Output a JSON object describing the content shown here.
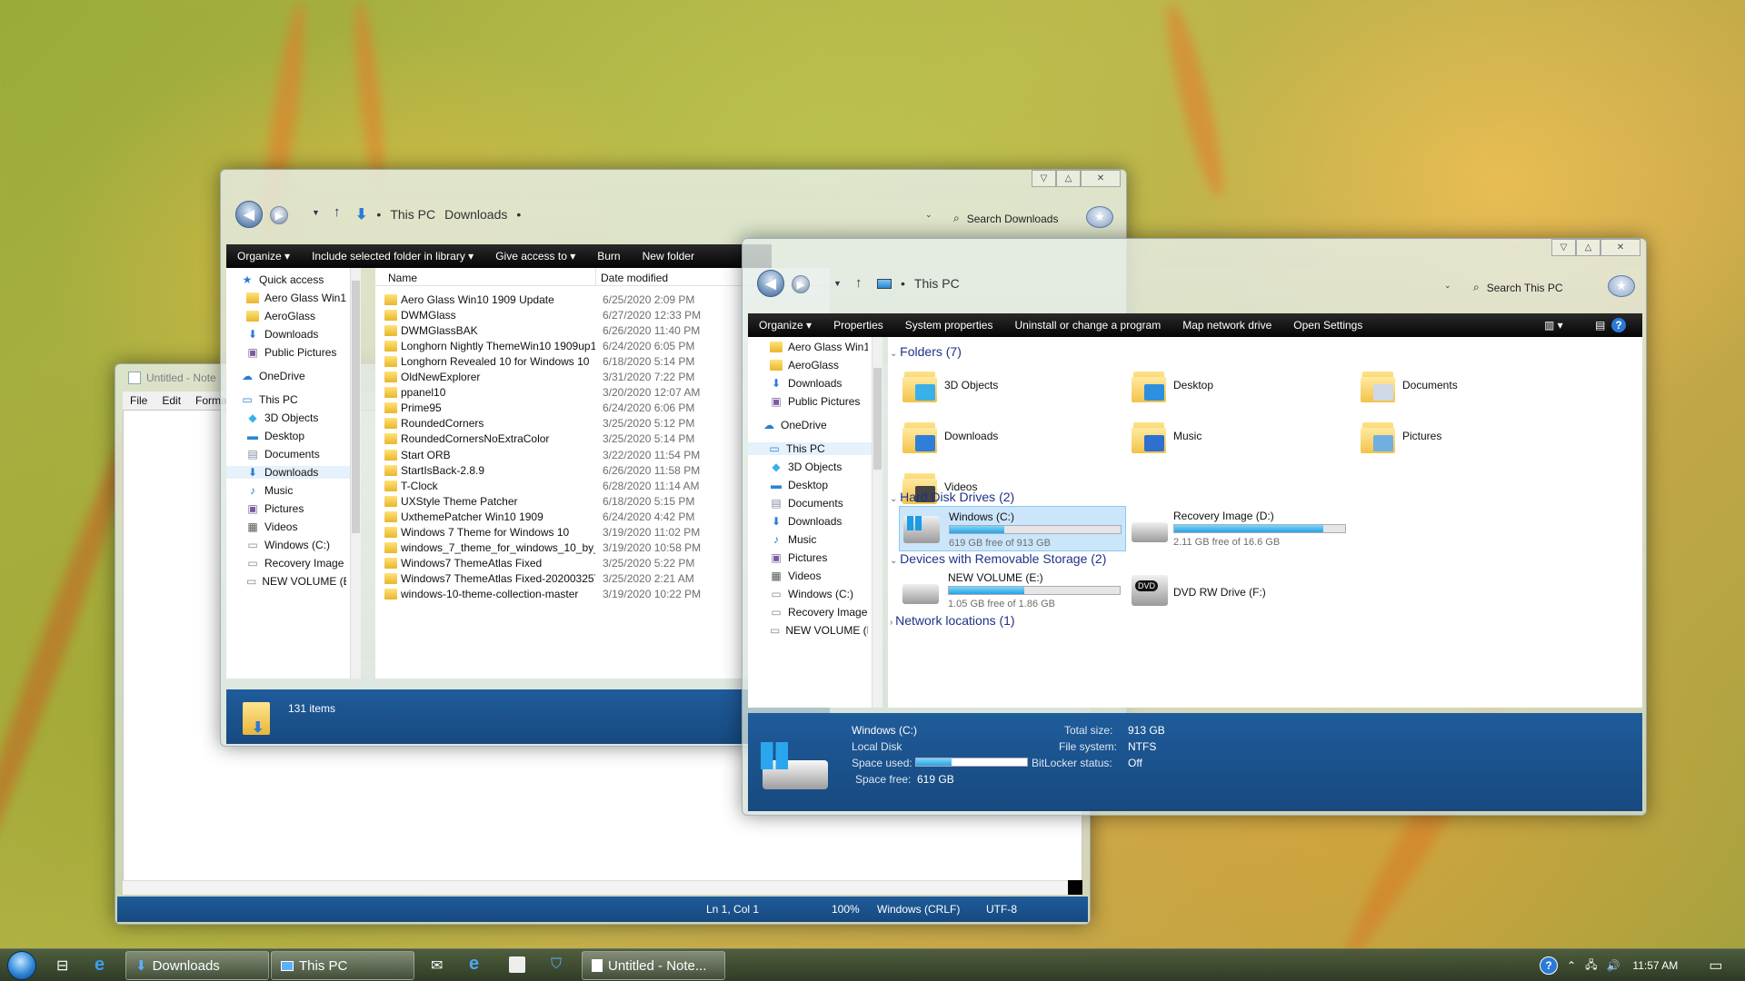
{
  "notepad": {
    "title": "Untitled - Note",
    "menu": [
      "File",
      "Edit",
      "Format"
    ],
    "status": {
      "position": "Ln 1, Col 1",
      "zoom": "100%",
      "eol": "Windows (CRLF)",
      "encoding": "UTF-8"
    }
  },
  "downloads_window": {
    "breadcrumb": [
      "This PC",
      "Downloads"
    ],
    "search_placeholder": "Search Downloads",
    "toolbar": [
      "Organize ▾",
      "Include selected folder in library ▾",
      "Give access to ▾",
      "Burn",
      "New folder"
    ],
    "nav": [
      {
        "label": "Quick access",
        "icon": "star-icon"
      },
      {
        "label": "Aero Glass Win1",
        "icon": "folder-icon"
      },
      {
        "label": "AeroGlass",
        "icon": "folder-icon"
      },
      {
        "label": "Downloads",
        "icon": "download-icon"
      },
      {
        "label": "Public Pictures",
        "icon": "pictures-icon"
      },
      {
        "label": "OneDrive",
        "icon": "cloud-icon"
      },
      {
        "label": "This PC",
        "icon": "computer-icon"
      },
      {
        "label": "3D Objects",
        "icon": "cube-icon"
      },
      {
        "label": "Desktop",
        "icon": "desktop-icon"
      },
      {
        "label": "Documents",
        "icon": "documents-icon"
      },
      {
        "label": "Downloads",
        "icon": "download-icon"
      },
      {
        "label": "Music",
        "icon": "music-icon"
      },
      {
        "label": "Pictures",
        "icon": "pictures-icon"
      },
      {
        "label": "Videos",
        "icon": "videos-icon"
      },
      {
        "label": "Windows (C:)",
        "icon": "drive-icon"
      },
      {
        "label": "Recovery Image",
        "icon": "drive-icon"
      },
      {
        "label": "NEW VOLUME (E",
        "icon": "drive-icon"
      }
    ],
    "columns": [
      "Name",
      "Date modified"
    ],
    "files": [
      [
        "Aero Glass Win10 1909 Update",
        "6/25/2020 2:09 PM"
      ],
      [
        "DWMGlass",
        "6/27/2020 12:33 PM"
      ],
      [
        "DWMGlassBAK",
        "6/26/2020 11:40 PM"
      ],
      [
        "Longhorn Nightly ThemeWin10 1909up1",
        "6/24/2020 6:05 PM"
      ],
      [
        "Longhorn Revealed 10 for Windows 10",
        "6/18/2020 5:14 PM"
      ],
      [
        "OldNewExplorer",
        "3/31/2020 7:22 PM"
      ],
      [
        "ppanel10",
        "3/20/2020 12:07 AM"
      ],
      [
        "Prime95",
        "6/24/2020 6:06 PM"
      ],
      [
        "RoundedCorners",
        "3/25/2020 5:12 PM"
      ],
      [
        "RoundedCornersNoExtraColor",
        "3/25/2020 5:14 PM"
      ],
      [
        "Start ORB",
        "3/22/2020 11:54 PM"
      ],
      [
        "StartIsBack-2.8.9",
        "6/26/2020 11:58 PM"
      ],
      [
        "T-Clock",
        "6/28/2020 11:14 AM"
      ],
      [
        "UXStyle Theme Patcher",
        "6/18/2020 5:15 PM"
      ],
      [
        "UxthemePatcher Win10 1909",
        "6/24/2020 4:42 PM"
      ],
      [
        "Windows 7 Theme for Windows 10",
        "3/19/2020 11:02 PM"
      ],
      [
        "windows_7_theme_for_windows_10_by_...",
        "3/19/2020 10:58 PM"
      ],
      [
        "Windows7 ThemeAtlas Fixed",
        "3/25/2020 5:22 PM"
      ],
      [
        "Windows7 ThemeAtlas Fixed-20200325T0...",
        "3/25/2020 2:21 AM"
      ],
      [
        "windows-10-theme-collection-master",
        "3/19/2020 10:22 PM"
      ]
    ],
    "status_count": "131 items"
  },
  "thispc_window": {
    "breadcrumb": "This PC",
    "search_placeholder": "Search This PC",
    "toolbar": [
      "Organize ▾",
      "Properties",
      "System properties",
      "Uninstall or change a program",
      "Map network drive",
      "Open Settings"
    ],
    "nav": [
      {
        "label": "Aero Glass Win1",
        "icon": "folder-icon"
      },
      {
        "label": "AeroGlass",
        "icon": "folder-icon"
      },
      {
        "label": "Downloads",
        "icon": "download-icon"
      },
      {
        "label": "Public Pictures",
        "icon": "pictures-icon"
      },
      {
        "label": "OneDrive",
        "icon": "cloud-icon"
      },
      {
        "label": "This PC",
        "icon": "computer-icon"
      },
      {
        "label": "3D Objects",
        "icon": "cube-icon"
      },
      {
        "label": "Desktop",
        "icon": "desktop-icon"
      },
      {
        "label": "Documents",
        "icon": "documents-icon"
      },
      {
        "label": "Downloads",
        "icon": "download-icon"
      },
      {
        "label": "Music",
        "icon": "music-icon"
      },
      {
        "label": "Pictures",
        "icon": "pictures-icon"
      },
      {
        "label": "Videos",
        "icon": "videos-icon"
      },
      {
        "label": "Windows (C:)",
        "icon": "drive-icon"
      },
      {
        "label": "Recovery Image",
        "icon": "drive-icon"
      },
      {
        "label": "NEW VOLUME (E",
        "icon": "drive-icon"
      }
    ],
    "groups": {
      "folders": "Folders (7)",
      "hdd": "Hard Disk Drives (2)",
      "removable": "Devices with Removable Storage (2)",
      "network": "Network locations (1)"
    },
    "folders": [
      {
        "label": "3D Objects",
        "overlay_color": "#3ab0e8"
      },
      {
        "label": "Desktop",
        "overlay_color": "#2d8fe0"
      },
      {
        "label": "Documents",
        "overlay_color": "#cfd8e6"
      },
      {
        "label": "Downloads",
        "overlay_color": "#2f7fd8"
      },
      {
        "label": "Music",
        "overlay_color": "#2f6fd0"
      },
      {
        "label": "Pictures",
        "overlay_color": "#6fb0e0"
      },
      {
        "label": "Videos",
        "overlay_color": "#444444"
      }
    ],
    "drives": [
      {
        "label": "Windows (C:)",
        "free": "619 GB free of 913 GB",
        "used_fraction": 0.32
      },
      {
        "label": "Recovery Image (D:)",
        "free": "2.11 GB free of 16.6 GB",
        "used_fraction": 0.87
      },
      {
        "label": "NEW VOLUME (E:)",
        "free": "1.05 GB free of 1.86 GB",
        "used_fraction": 0.44
      },
      {
        "label": "DVD RW Drive (F:)",
        "badge": "DVD"
      }
    ],
    "details": {
      "name": "Windows (C:)",
      "type": "Local Disk",
      "space_used_label": "Space used:",
      "space_free_label": "Space free:",
      "space_free": "619 GB",
      "total_size_label": "Total size:",
      "total_size": "913 GB",
      "fs_label": "File system:",
      "fs": "NTFS",
      "bitlocker_label": "BitLocker status:",
      "bitlocker": "Off",
      "used_fraction": 0.32
    }
  },
  "taskbar": {
    "buttons": [
      "Downloads",
      "This PC",
      "Untitled - Note..."
    ],
    "clock": "11:57 AM"
  }
}
